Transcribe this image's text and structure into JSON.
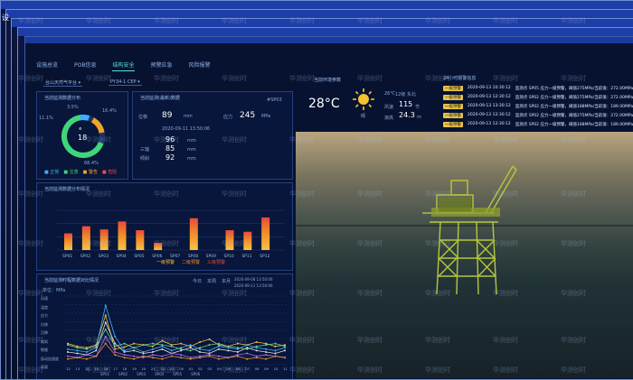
{
  "watermark": "华测创时",
  "title_char": "设",
  "nav": {
    "tabs": [
      "设施总览",
      "POB信息",
      "结构安全",
      "预警应急",
      "风险报警"
    ],
    "active": 2
  },
  "selectors": {
    "platform": "台山天然气平台 ▾",
    "tower": "PY34-1 CEP ▾"
  },
  "health": {
    "title": "当前监测数据分布",
    "pct_top_left": "3.5%",
    "pct_top_right": "16.4%",
    "pct_left": "11.1%",
    "center_value": "18",
    "pct_bottom": "68.4%",
    "legend": [
      "■ 正常",
      "■ 注意",
      "■ 警告",
      "■ 危险"
    ]
  },
  "latest": {
    "title": "当前监测(最新)数据",
    "id": "#SP03",
    "rows": [
      {
        "label": "位移",
        "value": "89",
        "unit": "mm"
      },
      {
        "label": "应力",
        "value": "245",
        "unit": "MPa"
      }
    ],
    "time": "2020-09-11 13:50:06",
    "subvals": [
      "96",
      "85",
      "92"
    ],
    "sublabels": [
      "三轴",
      "倾斜"
    ],
    "subunits": [
      "mm",
      "mm",
      "mm"
    ]
  },
  "bars": {
    "title": "当前监测数据分布情况",
    "legend": [
      "一级预警",
      "二级预警",
      "三级预警"
    ]
  },
  "trend": {
    "title": "当前监测时程数据对比情况",
    "filters": [
      "今日",
      "本周",
      "本月"
    ],
    "date_from": "2020-09-08 13:50:06",
    "date_to": "2020-09-11 13:50:06",
    "unit": "单位：MPa",
    "ylabels": [
      "风速",
      "温度",
      "应力",
      "位移",
      "沉降",
      "倾斜",
      "裂缝",
      "振动加速度",
      "雨量"
    ],
    "legend": [
      "SP01",
      "SP02",
      "SP03",
      "SP04",
      "SP05",
      "SP06"
    ]
  },
  "weather": {
    "title": "当前环境参数",
    "temp": "28°C",
    "sky": "晴",
    "items": [
      {
        "label": "26℃",
        "sub": "温度"
      },
      {
        "label": "12级",
        "sub": "风力"
      },
      {
        "label": "东北",
        "sub": "风向"
      }
    ],
    "wind_label": "风速",
    "wind_value": "115",
    "wind_unit": "节",
    "wave_label": "浪高",
    "wave_value": "24.3",
    "wave_unit": "m"
  },
  "alarm": {
    "title": "24小时报警信息",
    "rows": [
      {
        "level": "一级预警",
        "time": "2020-09-13 10:30:12",
        "msg": "监测点 SP05 应力一级预警，阈值275MPa/当前值：272.00MPa"
      },
      {
        "level": "一级预警",
        "time": "2020-09-13 12:30:12",
        "msg": "监测点 SP02 应力一级预警，阈值275MPa/当前值：272.00MPa"
      },
      {
        "level": "一级预警",
        "time": "2020-09-13 13:30:12",
        "msg": "监测点 SP02 应力一级预警，阈值188MPa/当前值：189.00MPa"
      },
      {
        "level": "一级预警",
        "time": "2020-09-13 12:30:12",
        "msg": "监测点 SP02 应力一级预警，阈值275MPa/当前值：272.00MPa"
      },
      {
        "level": "一级预警",
        "time": "2020-09-13 12:30:12",
        "msg": "监测点 SP02 应力一级预警，阈值188MPa/当前值：189.00MPa"
      }
    ]
  },
  "chart_data": [
    {
      "type": "bar",
      "categories": [
        "SP01",
        "SP02",
        "SP03",
        "SP04",
        "SP05",
        "SP06",
        "SP07",
        "SP08",
        "SP09",
        "SP10",
        "SP11",
        "SP12"
      ],
      "values": [
        42,
        60,
        52,
        72,
        50,
        18,
        0,
        80,
        0,
        50,
        46,
        82
      ],
      "ylim": [
        0,
        100
      ],
      "title": "当前监测数据分布情况"
    },
    {
      "type": "line",
      "x": [
        "12",
        "13",
        "14",
        "15",
        "16",
        "17",
        "18",
        "19",
        "20",
        "21",
        "22",
        "23",
        "00",
        "01",
        "02",
        "03",
        "04",
        "05",
        "06",
        "07",
        "08",
        "09",
        "10",
        "11"
      ],
      "series": [
        {
          "name": "SP01",
          "values": [
            30,
            26,
            24,
            28,
            70,
            22,
            25,
            30,
            28,
            26,
            34,
            28,
            30,
            26,
            32,
            36,
            28,
            26,
            30,
            28,
            32,
            30,
            26,
            28
          ]
        },
        {
          "name": "SP02",
          "values": [
            22,
            20,
            18,
            24,
            84,
            40,
            20,
            24,
            18,
            22,
            26,
            20,
            24,
            28,
            22,
            20,
            26,
            24,
            22,
            28,
            24,
            22,
            20,
            24
          ]
        },
        {
          "name": "SP03",
          "values": [
            18,
            16,
            14,
            20,
            60,
            30,
            18,
            20,
            16,
            18,
            22,
            16,
            20,
            24,
            18,
            16,
            22,
            20,
            18,
            24,
            20,
            18,
            16,
            20
          ]
        },
        {
          "name": "SP04",
          "values": [
            28,
            24,
            22,
            26,
            50,
            26,
            30,
            24,
            28,
            30,
            28,
            26,
            22,
            20,
            24,
            28,
            30,
            26,
            24,
            22,
            26,
            28,
            30,
            26
          ]
        },
        {
          "name": "SP05",
          "values": [
            12,
            10,
            14,
            12,
            40,
            18,
            14,
            12,
            10,
            14,
            12,
            16,
            14,
            10,
            12,
            14,
            12,
            10,
            14,
            16,
            12,
            14,
            12,
            10
          ]
        },
        {
          "name": "SP06",
          "values": [
            8,
            10,
            8,
            12,
            30,
            14,
            10,
            8,
            12,
            10,
            8,
            12,
            10,
            8,
            10,
            12,
            8,
            10,
            12,
            8,
            10,
            8,
            12,
            10
          ]
        }
      ]
    }
  ]
}
